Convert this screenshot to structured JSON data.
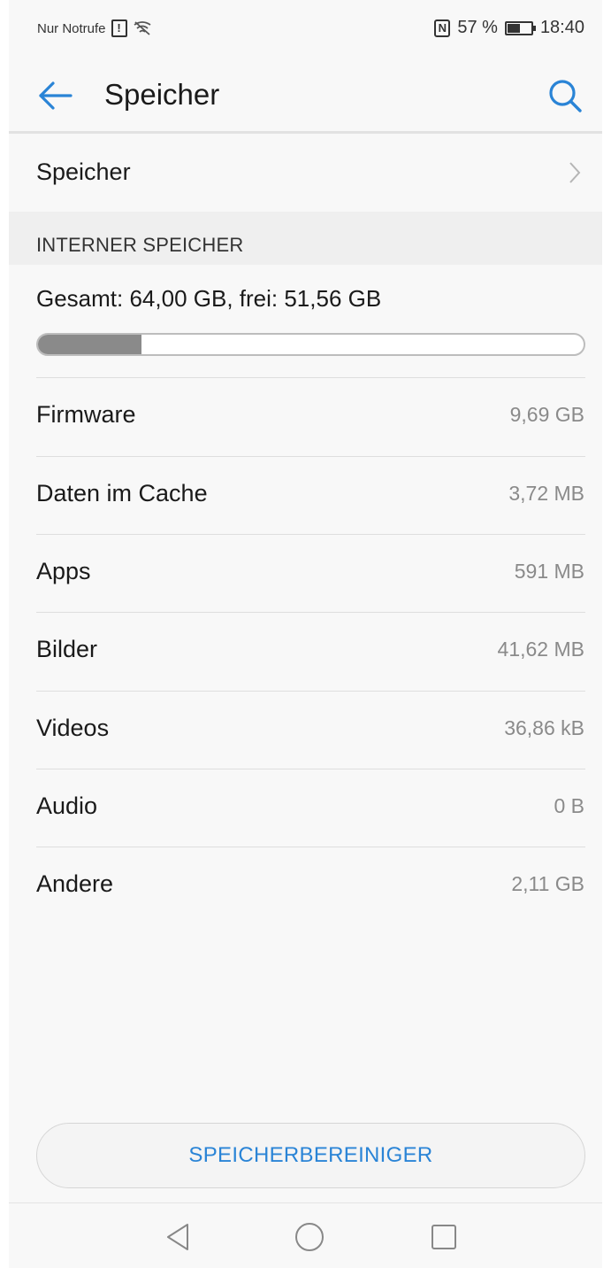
{
  "status_bar": {
    "carrier_text": "Nur Notrufe",
    "nfc_label": "N",
    "battery_percent": "57 %",
    "battery_level": 0.57,
    "time": "18:40",
    "icons": [
      "sim-alert-icon",
      "wifi-off-icon",
      "nfc-icon",
      "battery-icon"
    ]
  },
  "app_bar": {
    "title": "Speicher",
    "back_icon": "arrow-left-icon",
    "search_icon": "search-icon",
    "accent_color": "#2a84d6"
  },
  "storage_row": {
    "label": "Speicher"
  },
  "internal": {
    "section_header": "INTERNER SPEICHER",
    "summary": "Gesamt: 64,00 GB, frei: 51,56 GB",
    "used_fraction": 0.19
  },
  "items": [
    {
      "name": "Firmware",
      "size": "9,69 GB"
    },
    {
      "name": "Daten im Cache",
      "size": "3,72 MB"
    },
    {
      "name": "Apps",
      "size": "591 MB"
    },
    {
      "name": "Bilder",
      "size": "41,62 MB"
    },
    {
      "name": "Videos",
      "size": "36,86 kB"
    },
    {
      "name": "Audio",
      "size": "0 B"
    },
    {
      "name": "Andere",
      "size": "2,11 GB"
    }
  ],
  "cleaner_button": {
    "label": "SPEICHERBEREINIGER"
  },
  "nav_bar": {
    "icons": [
      "back-triangle-icon",
      "home-circle-icon",
      "recents-square-icon"
    ]
  }
}
